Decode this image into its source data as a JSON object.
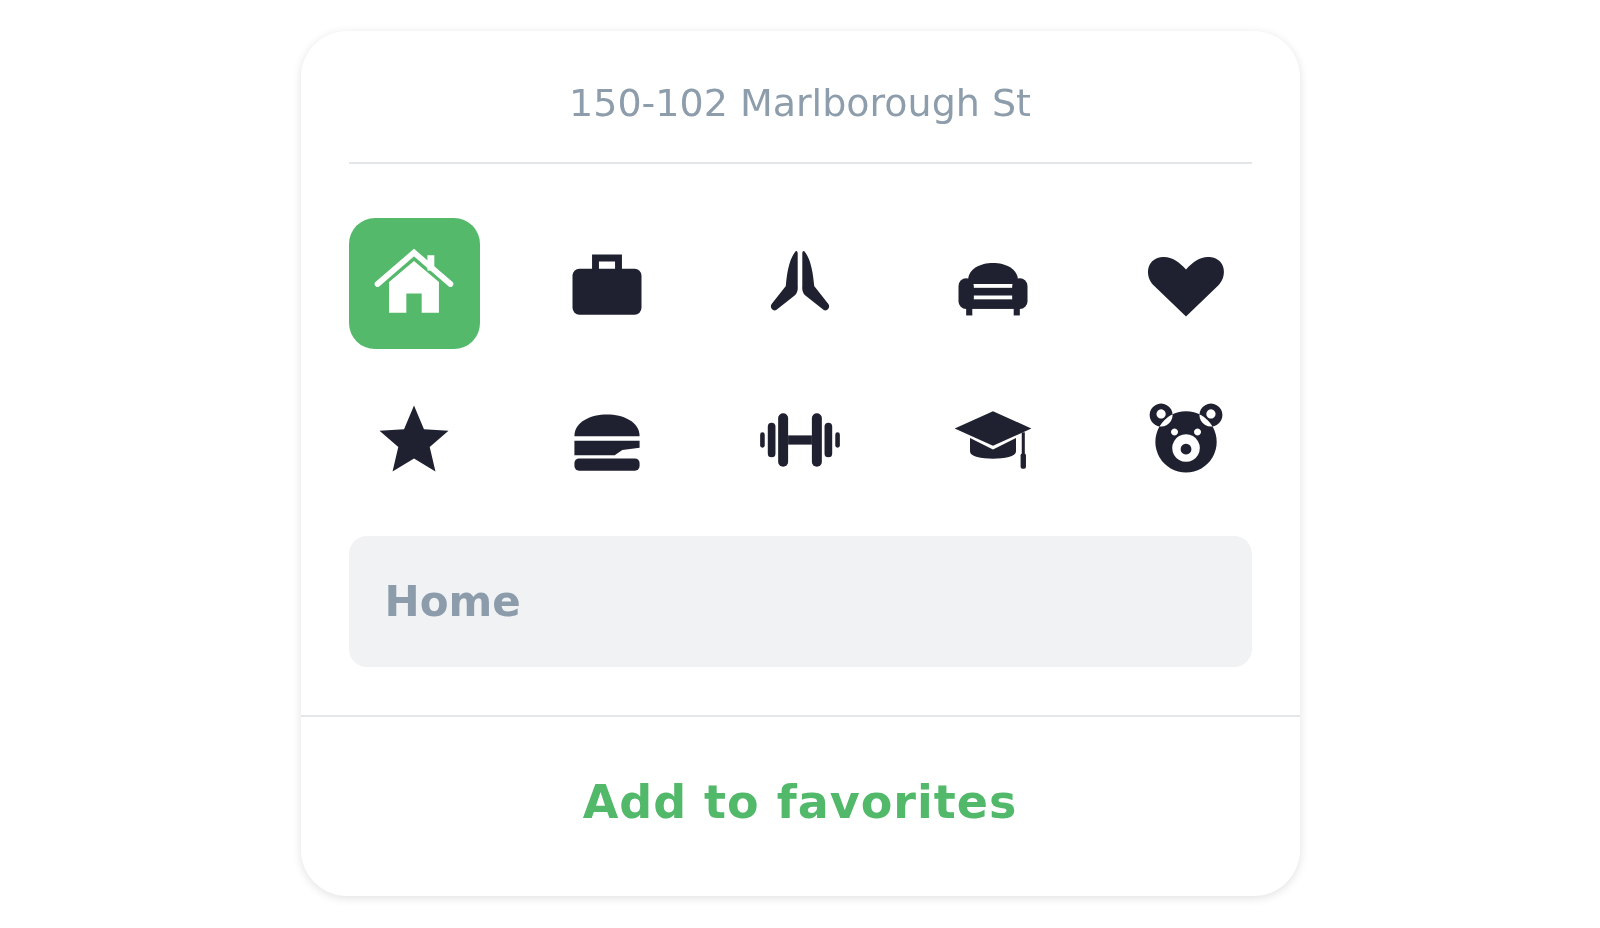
{
  "address": "150-102 Marlborough St",
  "icons": [
    {
      "kind": "house",
      "selected": true
    },
    {
      "kind": "briefcase",
      "selected": false
    },
    {
      "kind": "hands",
      "selected": false
    },
    {
      "kind": "armchair",
      "selected": false
    },
    {
      "kind": "heart",
      "selected": false
    },
    {
      "kind": "star",
      "selected": false
    },
    {
      "kind": "burger",
      "selected": false
    },
    {
      "kind": "dumbbell",
      "selected": false
    },
    {
      "kind": "cap",
      "selected": false
    },
    {
      "kind": "bear",
      "selected": false
    }
  ],
  "name_field": {
    "value": "Home"
  },
  "button": "Add to favorites"
}
